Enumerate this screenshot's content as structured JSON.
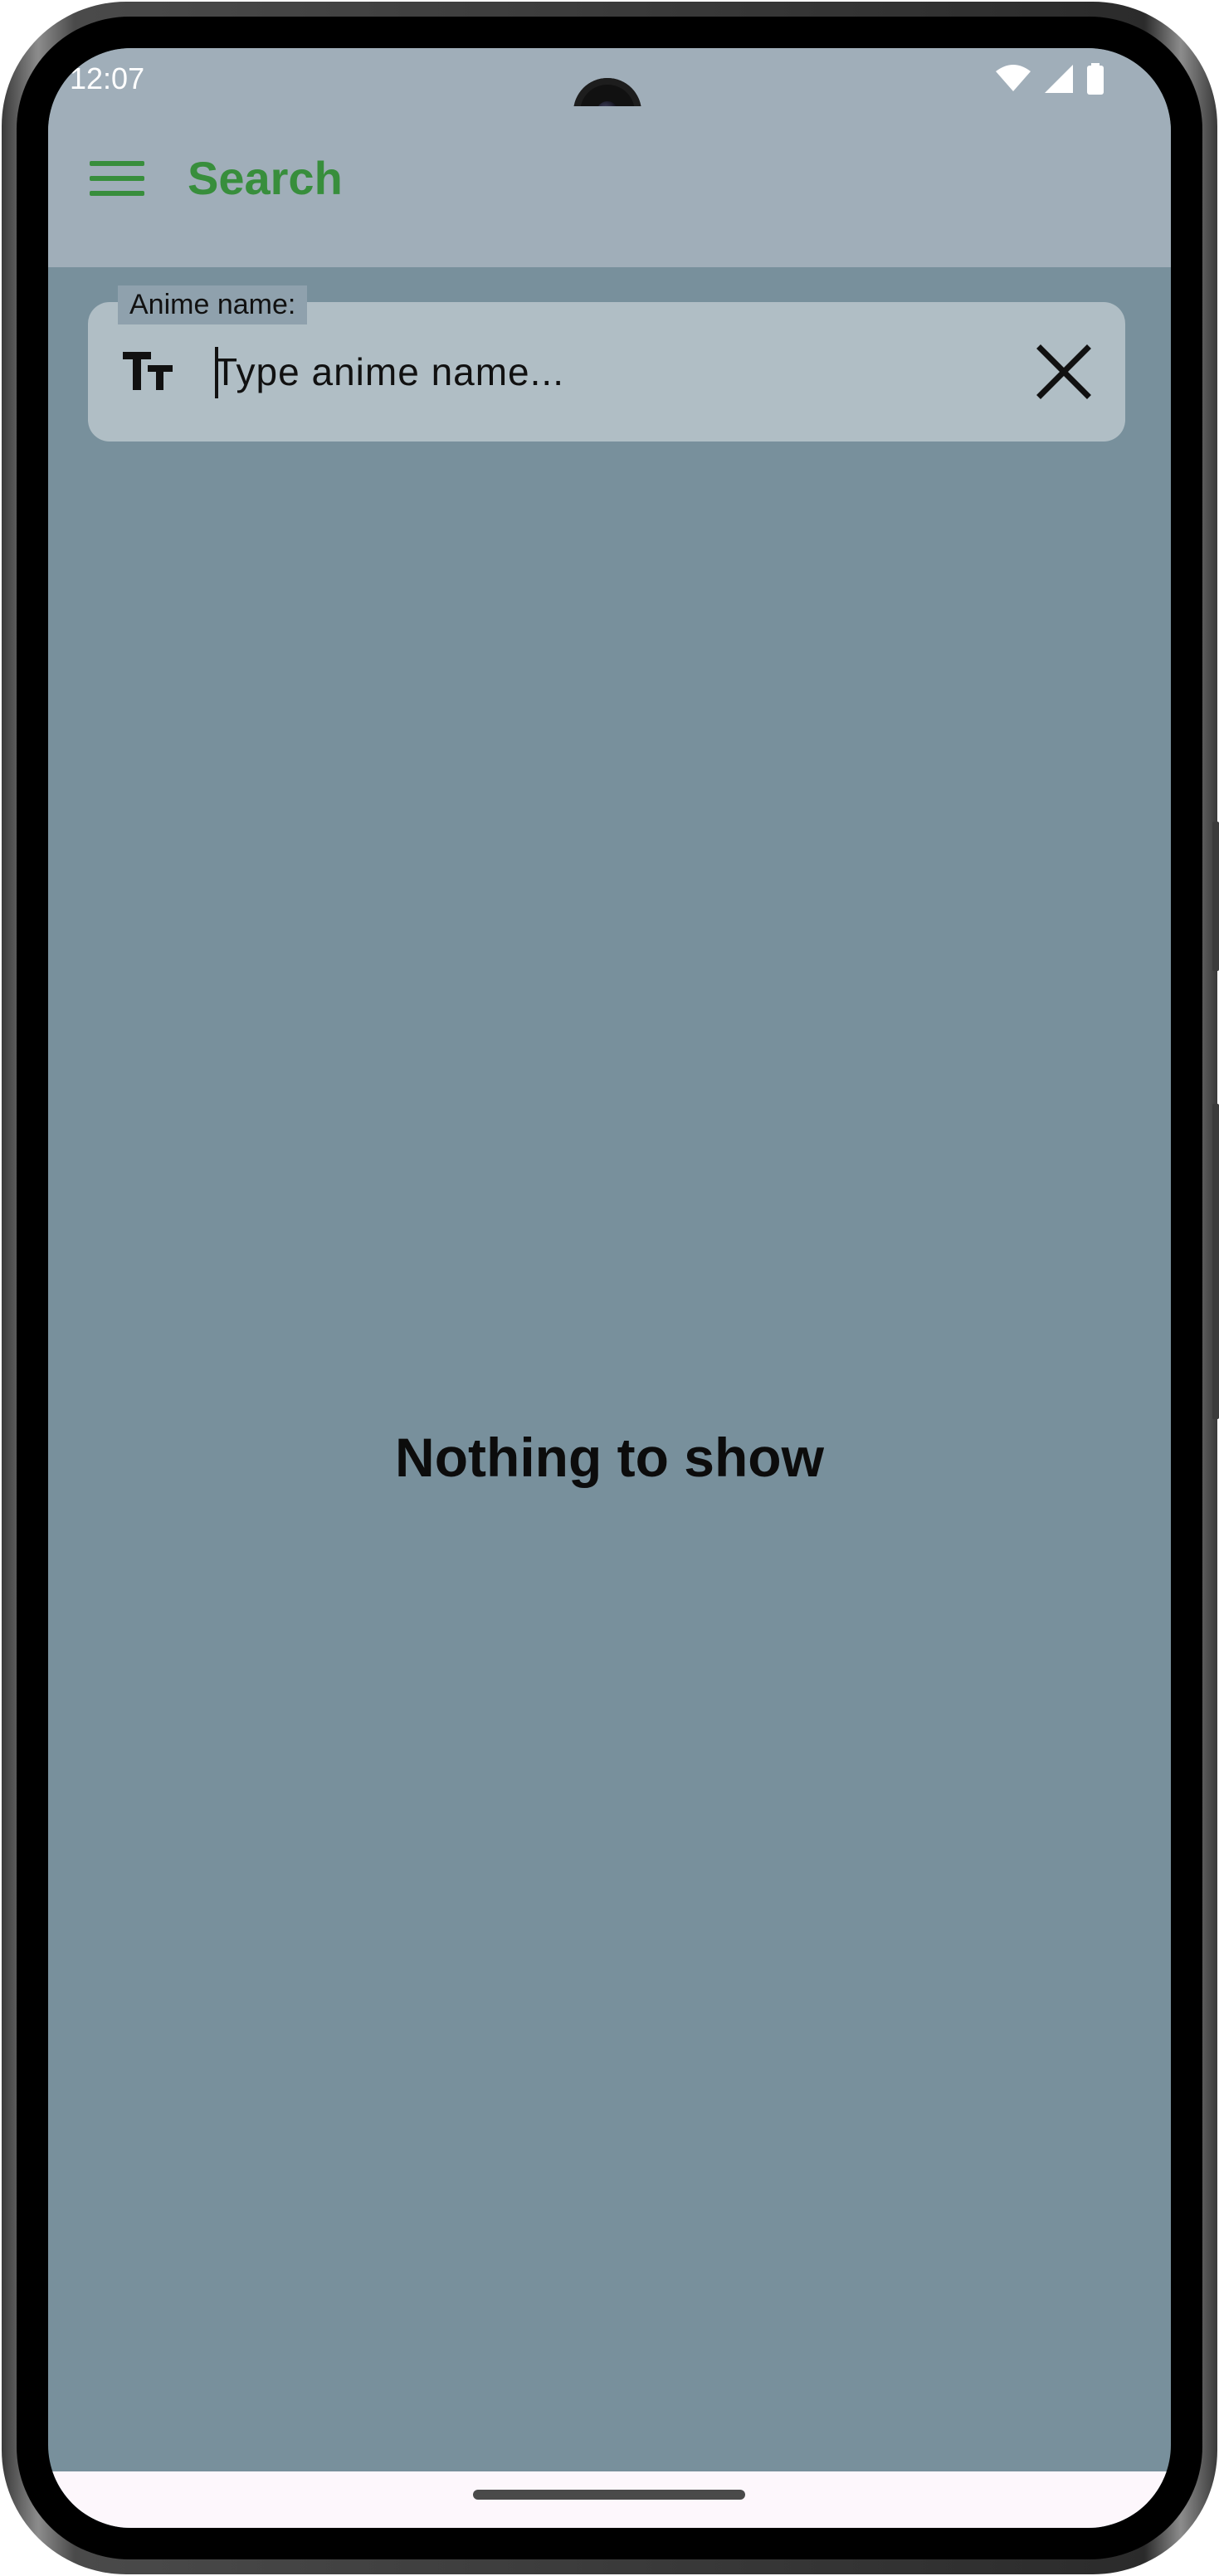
{
  "status_bar": {
    "time": "12:07",
    "icons": [
      "wifi-icon",
      "signal-icon",
      "battery-icon"
    ]
  },
  "app_bar": {
    "menu_icon": "menu-icon",
    "title": "Search"
  },
  "search": {
    "label": "Anime name:",
    "placeholder": "Type anime name...",
    "value": "",
    "leading_icon": "text-fields-icon",
    "trailing_icon": "close-icon"
  },
  "content": {
    "empty_message": "Nothing to show"
  },
  "colors": {
    "accent": "#388e3c",
    "app_bar_bg": "#a0aeb9",
    "screen_bg": "#78909c",
    "field_bg": "#b0bec5"
  }
}
